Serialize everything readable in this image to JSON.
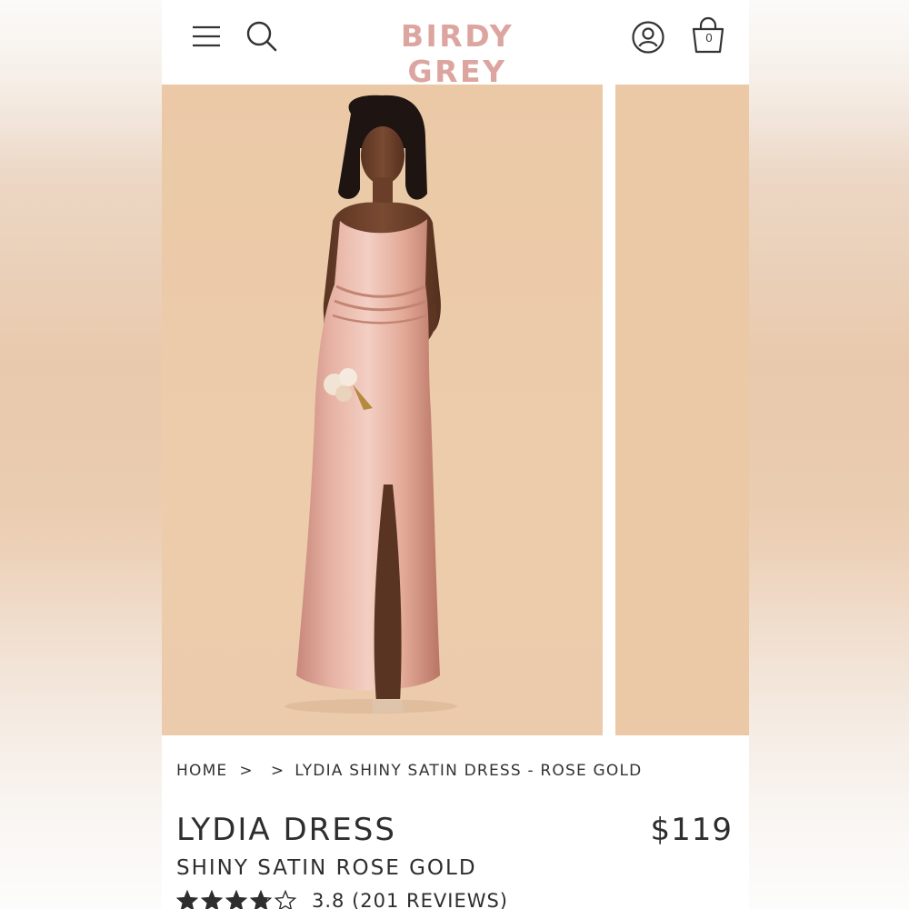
{
  "header": {
    "logo_text": "BIRDY GREY",
    "menu_icon": "hamburger-menu-icon",
    "search_icon": "search-icon",
    "account_icon": "user-account-icon",
    "cart_icon": "shopping-bag-icon",
    "cart_count": "0",
    "brand_color": "#dca5a0"
  },
  "gallery": {
    "slides": [
      {
        "name": "main-product-image",
        "subject": "model-in-rose-gold-satin-dress"
      },
      {
        "name": "next-product-image-peek"
      }
    ],
    "background_color": "#ebc9a7"
  },
  "breadcrumb": {
    "home": "HOME",
    "separator_1": ">",
    "separator_2": ">",
    "current": "LYDIA SHINY SATIN DRESS - ROSE GOLD"
  },
  "product": {
    "title": "LYDIA DRESS",
    "variant": "SHINY SATIN ROSE GOLD",
    "price": "$119",
    "rating_value": 3.8,
    "rating_max": 5,
    "rating_text": "3.8 (201 REVIEWS)",
    "text_color": "#2e2e2e"
  }
}
